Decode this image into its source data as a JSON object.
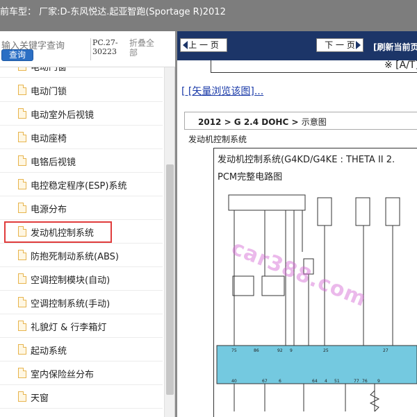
{
  "window": {
    "title": "前车型：  厂家:D-东风悦达.起亚智跑(Sportage R)2012"
  },
  "search": {
    "placeholder": "输入关键字查询",
    "button_label": "查询",
    "pc_code": "PC.27-30223",
    "collapse_all_label": "折叠全部"
  },
  "tree": {
    "items": [
      {
        "label": "电动门窗"
      },
      {
        "label": "电动门锁"
      },
      {
        "label": "电动室外后视镜"
      },
      {
        "label": "电动座椅"
      },
      {
        "label": "电铬后视镜"
      },
      {
        "label": "电控稳定程序(ESP)系统"
      },
      {
        "label": "电源分布"
      },
      {
        "label": "发动机控制系统",
        "highlighted": true
      },
      {
        "label": "防抱死制动系统(ABS)"
      },
      {
        "label": "空调控制模块(自动)"
      },
      {
        "label": "空调控制系统(手动)"
      },
      {
        "label": "礼貌灯 & 行李箱灯"
      },
      {
        "label": "起动系统"
      },
      {
        "label": "室内保险丝分布"
      },
      {
        "label": "天窗"
      }
    ]
  },
  "nav": {
    "prev_label": "上 一 页",
    "next_label": "下 一 页",
    "refresh_label": "[刷新当前页"
  },
  "doc": {
    "at_label": "※ [A/T]",
    "vector_link": "[ [矢量浏览该图]...",
    "path_main": "2012 > G 2.4 DOHC > ",
    "path_end": "示意图",
    "section_title": "发动机控制系统",
    "diagram_title": "发动机控制系统(G4KD/G4KE : THETA II 2.",
    "diagram_subtitle": "PCM完整电路图",
    "watermark": "car388.com"
  },
  "colors": {
    "titlebar_bg": "#7d7d7d",
    "navbar_bg": "#1c3568",
    "search_button": "#2b6fc4",
    "highlight_box": "#e03b3b",
    "link": "#1a3aa8",
    "pcm_block": "#74c9e0"
  }
}
